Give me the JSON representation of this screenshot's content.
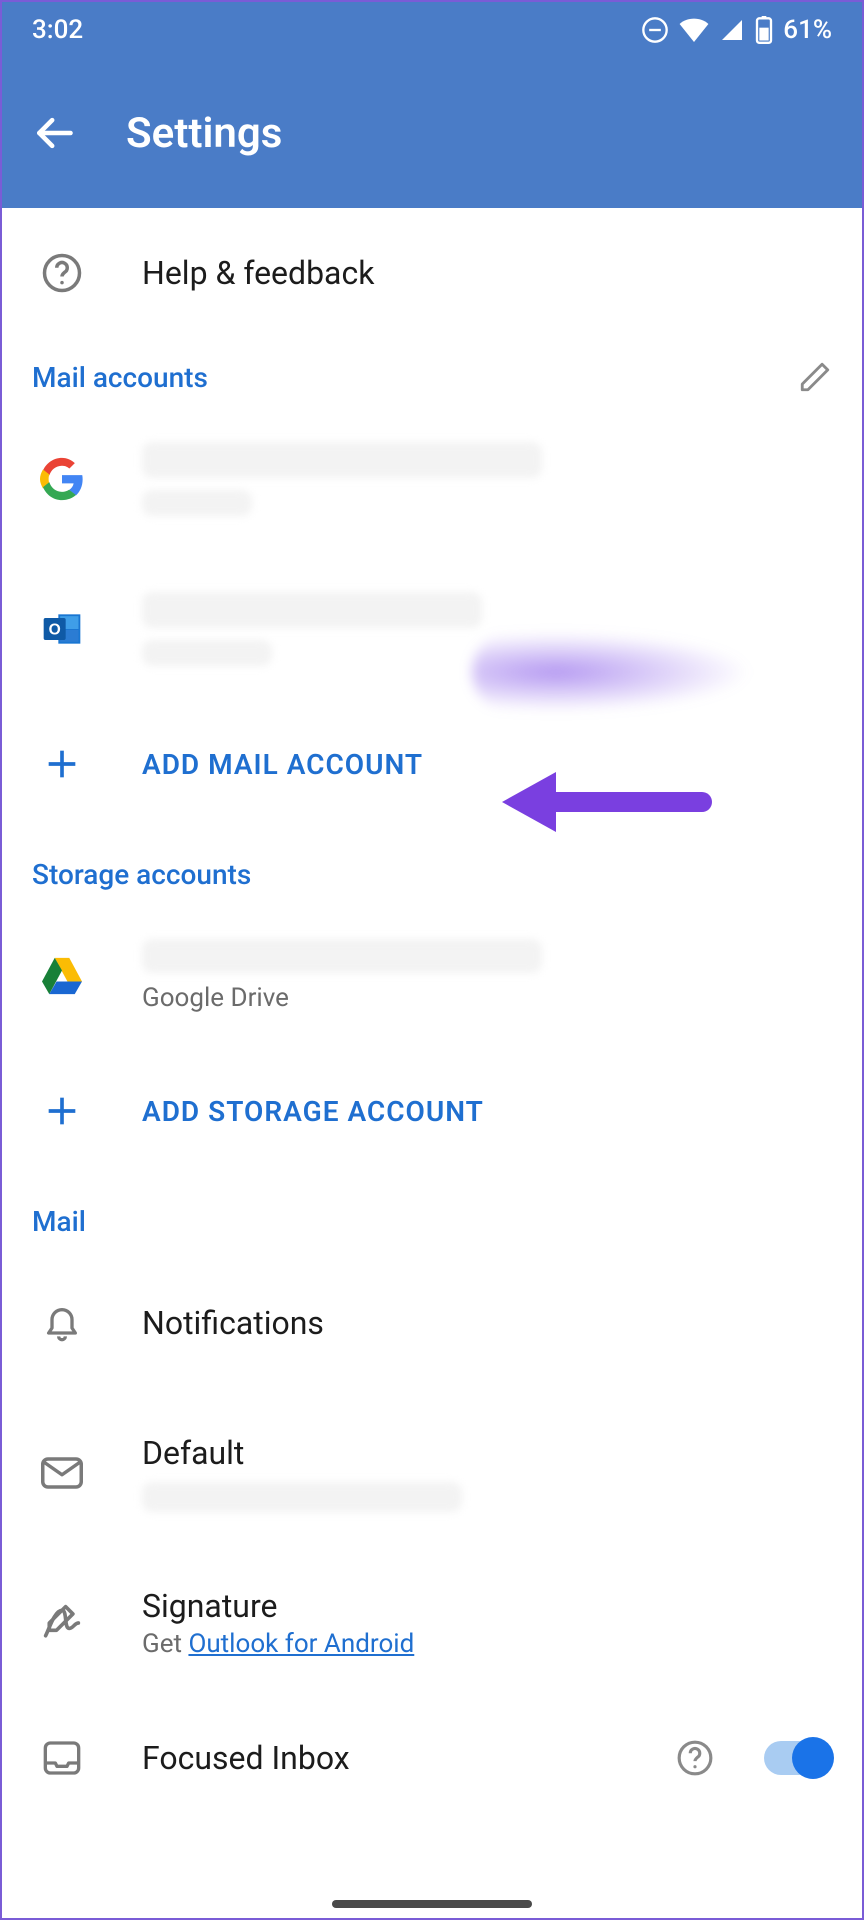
{
  "status": {
    "time": "3:02",
    "battery": "61%"
  },
  "header": {
    "title": "Settings"
  },
  "help_row": {
    "label": "Help & feedback"
  },
  "sections": {
    "mail_accounts": {
      "title": "Mail accounts"
    },
    "storage_accounts": {
      "title": "Storage accounts"
    },
    "mail": {
      "title": "Mail"
    }
  },
  "mail_accounts": [
    {
      "provider": "google"
    },
    {
      "provider": "outlook"
    }
  ],
  "add_mail": {
    "label": "ADD MAIL ACCOUNT"
  },
  "storage_accounts": [
    {
      "provider": "gdrive",
      "label": "Google Drive"
    }
  ],
  "add_storage": {
    "label": "ADD STORAGE ACCOUNT"
  },
  "mail_settings": {
    "notifications": {
      "label": "Notifications"
    },
    "default": {
      "label": "Default"
    },
    "signature": {
      "label": "Signature",
      "hint_prefix": "Get ",
      "hint_link": "Outlook for Android"
    },
    "focused": {
      "label": "Focused Inbox",
      "on": true
    }
  }
}
